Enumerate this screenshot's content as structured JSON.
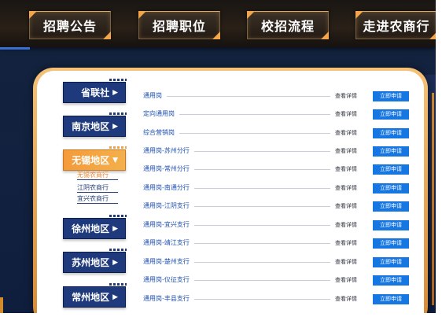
{
  "nav": {
    "tabs": [
      "招聘公告",
      "招聘职位",
      "校招流程",
      "走进农商行"
    ]
  },
  "sidebar": {
    "items": [
      {
        "label": "省联社",
        "arrow": "▶"
      },
      {
        "label": "南京地区",
        "arrow": "▶"
      },
      {
        "label": "无锡地区",
        "arrow": "▼",
        "active": true
      },
      {
        "label": "徐州地区",
        "arrow": "▶"
      },
      {
        "label": "苏州地区",
        "arrow": "▶"
      },
      {
        "label": "常州地区",
        "arrow": "▶"
      }
    ],
    "subitems": [
      "无锡农商行",
      "江阴农商行",
      "宜兴农商行"
    ]
  },
  "jobs": [
    {
      "title": "通用岗",
      "detail": "查看详情",
      "apply": "立即申请"
    },
    {
      "title": "定向通用岗",
      "detail": "查看详情",
      "apply": "立即申请"
    },
    {
      "title": "综合营销岗",
      "detail": "查看详情",
      "apply": "立即申请"
    },
    {
      "title": "通用岗-苏州分行",
      "detail": "查看详情",
      "apply": "立即申请"
    },
    {
      "title": "通用岗-常州分行",
      "detail": "查看详情",
      "apply": "立即申请"
    },
    {
      "title": "通用岗-南通分行",
      "detail": "查看详情",
      "apply": "立即申请"
    },
    {
      "title": "通用岗-江阴支行",
      "detail": "查看详情",
      "apply": "立即申请"
    },
    {
      "title": "通用岗-宜兴支行",
      "detail": "查看详情",
      "apply": "立即申请"
    },
    {
      "title": "通用岗-靖江支行",
      "detail": "查看详情",
      "apply": "立即申请"
    },
    {
      "title": "通用岗-楚州支行",
      "detail": "查看详情",
      "apply": "立即申请"
    },
    {
      "title": "通用岗-仪征支行",
      "detail": "查看详情",
      "apply": "立即申请"
    },
    {
      "title": "通用岗-丰县支行",
      "detail": "查看详情",
      "apply": "立即申请"
    }
  ],
  "colors": {
    "navy": "#1e3a7c",
    "accent_orange": "#f59a3a",
    "apply_blue": "#1677e3",
    "link_blue": "#1d4fb2"
  }
}
